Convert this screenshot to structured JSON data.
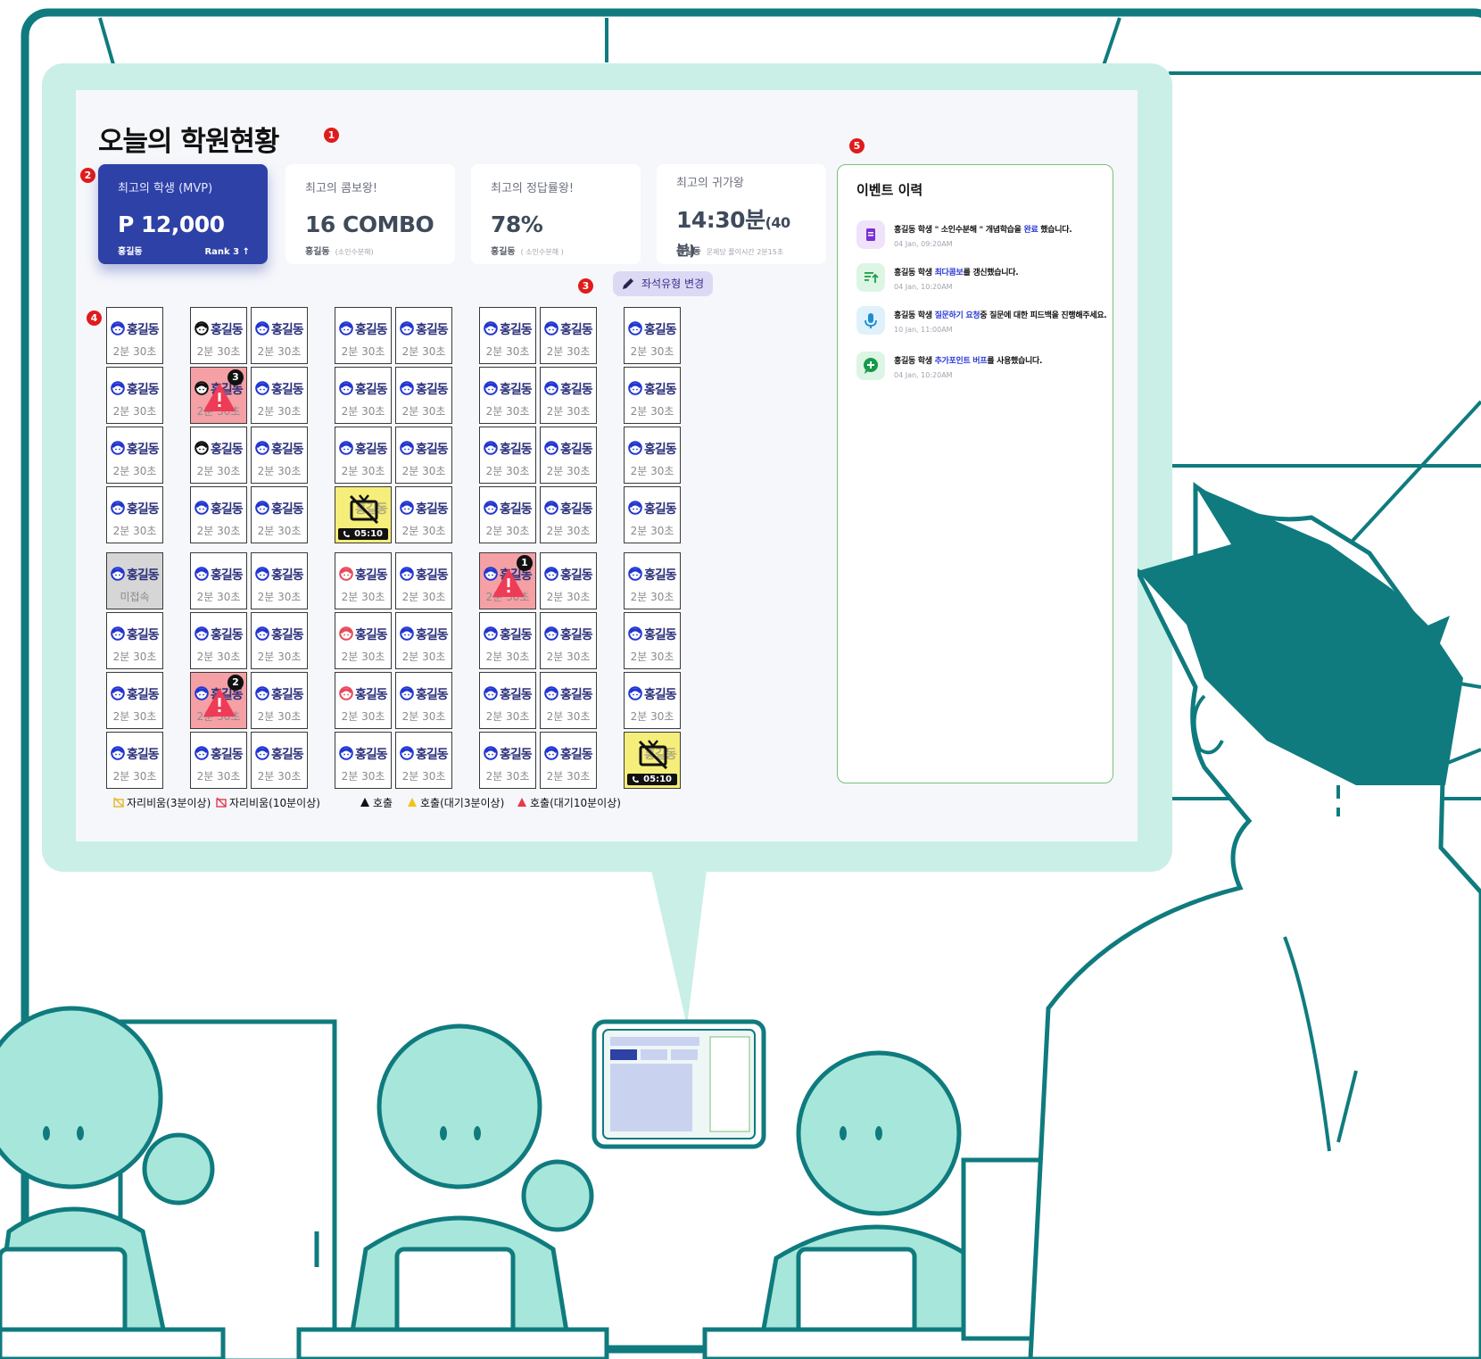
{
  "dashboard": {
    "title": "오늘의 학원현황",
    "badges": [
      "1",
      "2",
      "3",
      "4",
      "5"
    ]
  },
  "cards": {
    "mvp": {
      "label": "최고의 학생 (MVP)",
      "value": "P 12,000",
      "name": "홍길동",
      "rank": "Rank 3 ↑"
    },
    "combo": {
      "label": "최고의 콤보왕!",
      "value": "16 COMBO",
      "name": "홍길동",
      "detail": "(소인수분해)"
    },
    "accuracy": {
      "label": "최고의 정답률왕!",
      "value": "78%",
      "name": "홍길동",
      "detail": "( 소인수분해 )"
    },
    "return": {
      "label": "최고의 귀가왕",
      "value_main": "14:30분",
      "value_sub": "(40분)",
      "name": "홍길동",
      "detail": "문제당 풀이시간 2분15초"
    }
  },
  "seat_button": {
    "label": "좌석유형 변경",
    "icon": "pencil-icon"
  },
  "seats": {
    "name": "홍길동",
    "time": "2분 30초",
    "offline_text": "미접속",
    "call_timer": "05:10",
    "alert_counts": [
      "3",
      "1",
      "2"
    ]
  },
  "legend": {
    "away3": "자리비움(3분이상)",
    "away10": "자리비움(10분이상)",
    "call": "호출",
    "call_wait3": "호출(대기3분이상)",
    "call_wait10": "호출(대기10분이상)"
  },
  "events": {
    "title": "이벤트 이력",
    "items": [
      {
        "icon": "clipboard-icon",
        "pre": "홍길동 학생 \" 소인수분해 \" 개념학습을 ",
        "hl": "완료",
        "post": " 했습니다.",
        "date": "04 Jan, 09:20AM"
      },
      {
        "icon": "trend-icon",
        "pre": "홍길동 학생 ",
        "hl": "최다콤보",
        "post": "를 갱신했습니다.",
        "date": "04 Jan, 10:20AM"
      },
      {
        "icon": "microphone-icon",
        "pre": "홍길동 학생 ",
        "hl": "질문하기 요청",
        "post": "중 질문에 대한 피드백을 진행해주세요.",
        "date": "10 Jan, 11:00AM"
      },
      {
        "icon": "chat-plus-icon",
        "pre": "홍길동 학생 ",
        "hl": "추가포인트 버프",
        "post": "를 사용했습니다.",
        "date": "04 Jan, 10:20AM"
      }
    ]
  },
  "colors": {
    "teal": "#0f7b7e",
    "mint": "#a7e6da",
    "panel_frame": "#c9efe6",
    "mvp_card": "#2e41a7",
    "seat_alert": "#f4a0a4",
    "seat_away": "#f6ee7a"
  }
}
